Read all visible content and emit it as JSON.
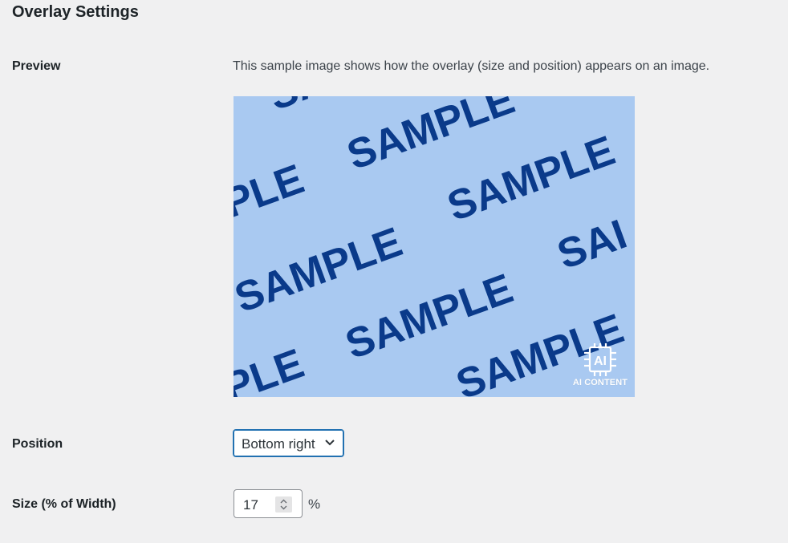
{
  "page": {
    "title": "Overlay Settings"
  },
  "preview": {
    "label": "Preview",
    "description": "This sample image shows how the overlay (size and position) appears on an image.",
    "pattern_word": "SAMPLE",
    "pattern_partial_a": "PLE",
    "pattern_partial_b": "SAI",
    "overlay": {
      "chip_text": "AI",
      "caption": "AI CONTENT",
      "icon": "chip-icon"
    },
    "colors": {
      "background": "#a9c9f1",
      "text": "#0a3a8a"
    }
  },
  "position": {
    "label": "Position",
    "selected": "Bottom right"
  },
  "size": {
    "label": "Size (% of Width)",
    "value": "17",
    "unit": "%"
  }
}
